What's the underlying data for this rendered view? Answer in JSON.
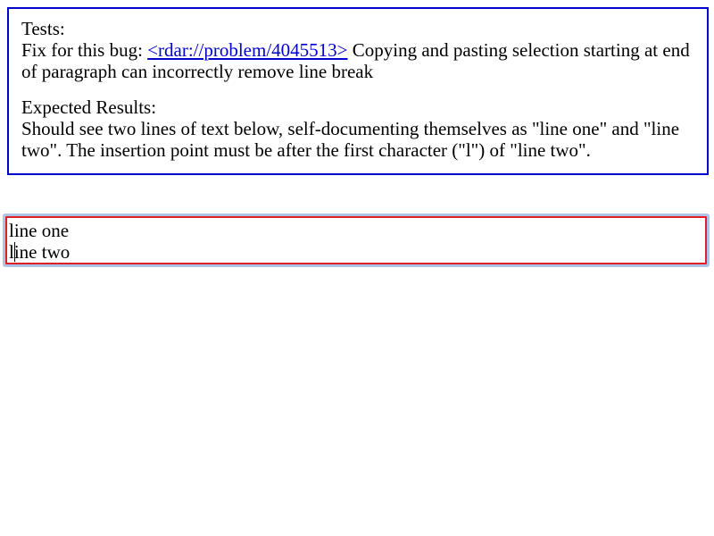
{
  "test_info": {
    "tests_heading": "Tests:",
    "bug_prefix": "Fix for this bug: ",
    "bug_link": "<rdar://problem/4045513>",
    "bug_description": " Copying and pasting selection starting at end of paragraph can incorrectly remove line break",
    "expected_heading": "Expected Results:",
    "expected_text": "Should see two lines of text below, self-documenting themselves as \"line one\" and \"line two\". The insertion point must be after the first character (\"l\") of \"line two\"."
  },
  "editable": {
    "line_one": "line one",
    "line_two_first_char": "l",
    "line_two_rest": "ine two"
  },
  "colors": {
    "info_border": "#0000cc",
    "link": "#0000cc",
    "editable_border": "#e02020",
    "focus_ring": "#aac4ea"
  }
}
